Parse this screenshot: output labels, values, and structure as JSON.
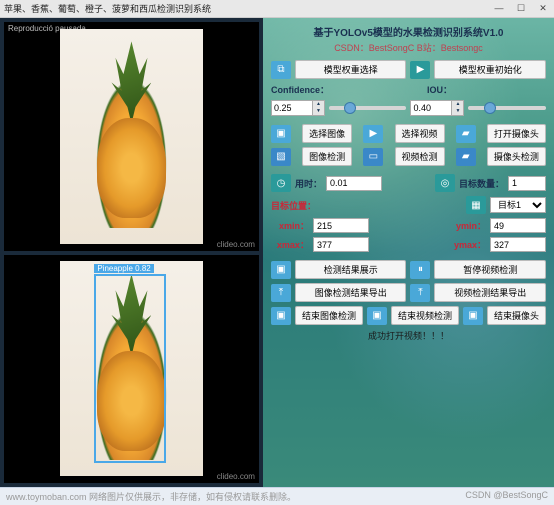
{
  "window": {
    "title": "苹果、香蕉、葡萄、橙子、菠萝和西瓜检测识别系统"
  },
  "win_controls": {
    "min": "—",
    "max": "☐",
    "close": "✕"
  },
  "overlay": {
    "pause": "Reproducció pausada",
    "clideo": "clideo.com"
  },
  "detection": {
    "label": "Pineapple  0.82"
  },
  "header": {
    "title": "基于YOLOv5模型的水果检测识别系统V1.0",
    "sub": "CSDN：BestSongC    B站：Bestsongc"
  },
  "model": {
    "select_btn": "模型权重选择",
    "init_btn": "模型权重初始化",
    "conf_label": "Confidence：",
    "conf_value": "0.25",
    "iou_label": "IOU：",
    "iou_value": "0.40"
  },
  "source": {
    "select_image": "选择图像",
    "select_video": "选择视频",
    "open_camera": "打开摄像头",
    "image_detect": "图像检测",
    "video_detect": "视频检测",
    "camera_detect": "摄像头检测"
  },
  "stats": {
    "time_label": "用时：",
    "time_value": "0.01",
    "count_label": "目标数量：",
    "count_value": "1",
    "pos_label": "目标位置：",
    "target_select": "目标1",
    "xmin_label": "xmin：",
    "xmin": "215",
    "ymin_label": "ymin：",
    "ymin": "49",
    "xmax_label": "xmax：",
    "xmax": "377",
    "ymax_label": "ymax：",
    "ymax": "327"
  },
  "ops": {
    "show_result": "检测结果展示",
    "pause_video": "暂停视频检测",
    "export_image": "图像检测结果导出",
    "export_video": "视频检测结果导出",
    "end_image": "结束图像检测",
    "end_video": "结束视频检测",
    "end_camera": "结束摄像头"
  },
  "status": "成功打开视频！！！",
  "footer": {
    "left": "www.toymoban.com 网络图片仅供展示，非存储，如有侵权请联系删除。",
    "right": "CSDN @BestSongC"
  },
  "icons": {
    "folder": "⧉",
    "image": "▣",
    "play": "▶",
    "camera": "▰",
    "clock": "◷",
    "target": "◎",
    "grid": "▦",
    "pause": "⏸",
    "upload": "⤒",
    "pic": "▧",
    "stop": "▣",
    "video": "▭"
  }
}
